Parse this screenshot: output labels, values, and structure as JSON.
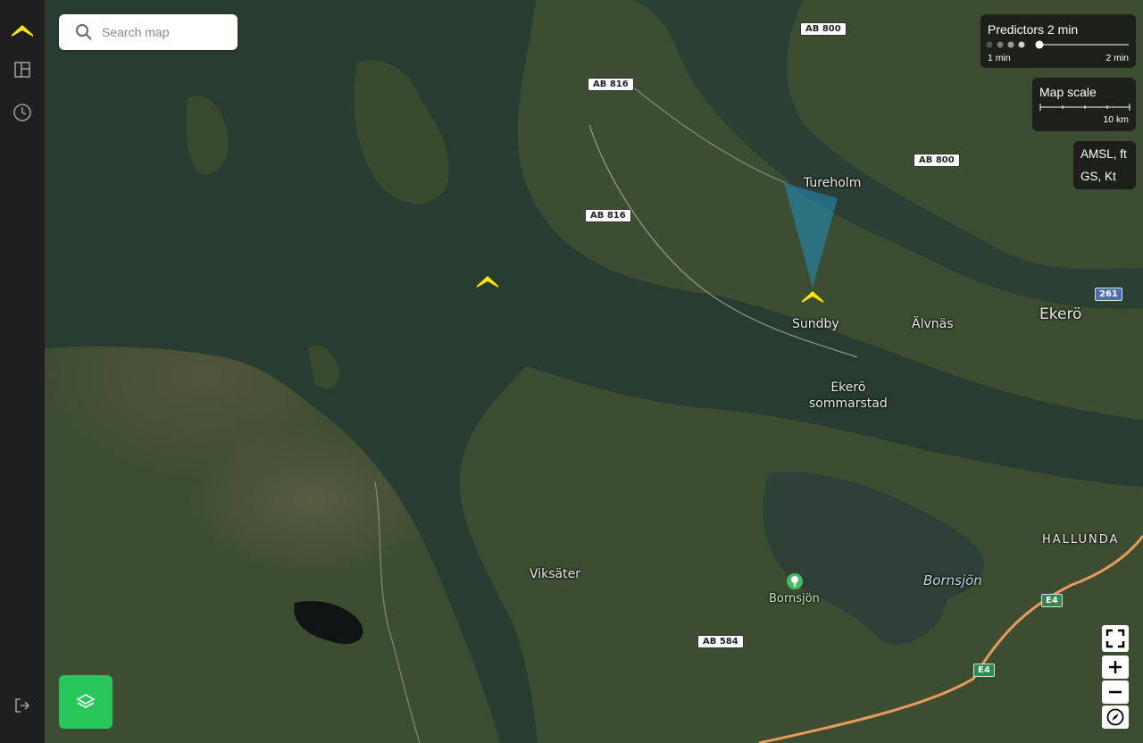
{
  "colors": {
    "sidebar": "#1e1f1e",
    "accent_yellow": "#ffe600",
    "layers_button": "#27c75a",
    "water": "#283c32",
    "land": "#3d4d31"
  },
  "sidebar": {
    "items": [
      {
        "icon": "logo-chevron-icon"
      },
      {
        "icon": "panel-layout-icon"
      },
      {
        "icon": "clock-icon"
      },
      {
        "icon": "logout-icon"
      }
    ]
  },
  "search": {
    "placeholder": "Search map",
    "value": ""
  },
  "predictors": {
    "title": "Predictors 2 min",
    "min_label": "1 min",
    "max_label": "2 min",
    "selected_step": 5,
    "steps": 5
  },
  "map_scale": {
    "title": "Map scale",
    "label": "10 km"
  },
  "units": {
    "altitude": "AMSL, ft",
    "speed": "GS, Kt"
  },
  "places": {
    "tureholm": "Tureholm",
    "sundby": "Sundby",
    "alvnas": "Älvnäs",
    "ekero": "Ekerö",
    "ekero_sommarstad": "Ekerö\nsommarstad",
    "hallunda": "HALLUNDA",
    "bornsjon_lake": "Bornsjön",
    "bornsjon_poi": "Bornsjön",
    "viksater": "Viksäter"
  },
  "roads": {
    "ab800_top": "AB 800",
    "ab816_top": "AB 816",
    "ab800_right": "AB 800",
    "ab816_mid": "AB 816",
    "r261": "261",
    "e4_upper": "E4",
    "e4_lower": "E4",
    "ab584": "AB 584"
  },
  "map_controls": [
    "fullscreen-icon",
    "zoom-in-icon",
    "zoom-out-icon",
    "compass-icon"
  ],
  "layers_button": {
    "icon": "layers-icon"
  }
}
